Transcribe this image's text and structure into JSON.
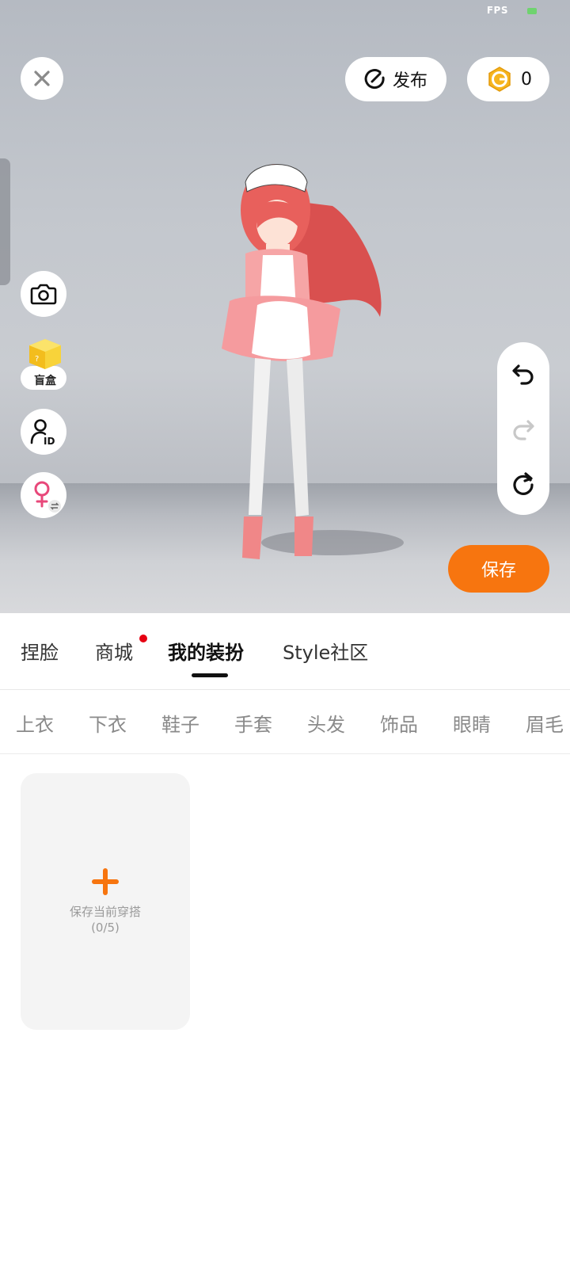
{
  "status": {
    "fps_label": "FPS"
  },
  "header": {
    "close_icon": "close-icon",
    "publish_label": "发布",
    "coin_count": "0"
  },
  "left_tools": {
    "camera_icon": "camera-icon",
    "blind_box_label": "盲盒",
    "id_icon": "user-id-icon",
    "gender_icon": "female-swap-icon"
  },
  "history": {
    "undo": "undo-icon",
    "redo": "redo-icon",
    "reset": "reset-icon"
  },
  "save_label": "保存",
  "tabs": [
    {
      "label": "捏脸"
    },
    {
      "label": "商城"
    },
    {
      "label": "我的装扮"
    },
    {
      "label": "Style社区"
    }
  ],
  "categories": [
    {
      "label": "上衣"
    },
    {
      "label": "下衣"
    },
    {
      "label": "鞋子"
    },
    {
      "label": "手套"
    },
    {
      "label": "头发"
    },
    {
      "label": "饰品"
    },
    {
      "label": "眼睛"
    },
    {
      "label": "眉毛"
    }
  ],
  "outfit_card": {
    "title": "保存当前穿搭",
    "count": "(0/5)"
  },
  "colors": {
    "accent": "#f7750f",
    "notification": "#e60012"
  }
}
